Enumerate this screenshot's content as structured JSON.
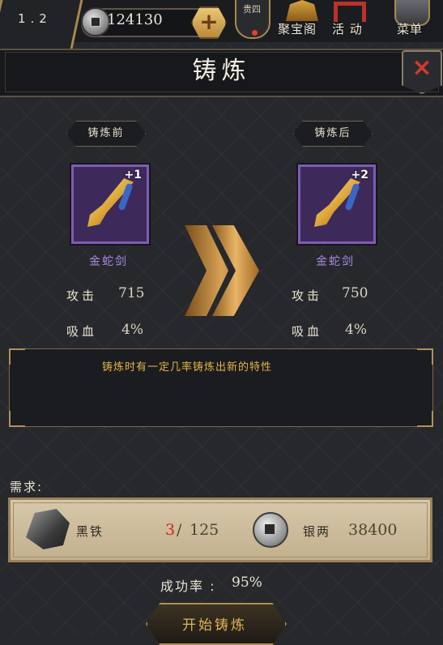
{
  "topbar": {
    "level": "1.2",
    "money": "124130",
    "plus_label": "+",
    "vip_label": "贵四",
    "buttons": {
      "treasure_label": "聚宝阁",
      "event_label": "活 动",
      "menu_label": "菜单"
    }
  },
  "title": "铸炼",
  "close_label": "×",
  "before": {
    "tag": "铸炼前",
    "item_name": "金蛇剑",
    "enhance": "+1",
    "stats": [
      {
        "label": "攻击",
        "value": "715"
      },
      {
        "label": "吸血",
        "value": "4%"
      }
    ]
  },
  "after": {
    "tag": "铸炼后",
    "item_name": "金蛇剑",
    "enhance": "+2",
    "stats": [
      {
        "label": "攻击",
        "value": "750"
      },
      {
        "label": "吸血",
        "value": "4%"
      }
    ]
  },
  "info_text": "铸炼时有一定几率铸炼出新的特性",
  "requirements": {
    "label": "需求:",
    "material": {
      "name": "黑铁",
      "have": "3",
      "separator": "/",
      "need": "125"
    },
    "currency": {
      "name": "银两",
      "amount": "38400"
    }
  },
  "success_rate": {
    "label": "成功率 :",
    "value": "95%"
  },
  "start_button": "开始铸炼",
  "colors": {
    "quality_purple": "#7b5fb0",
    "gold": "#e0b456",
    "insufficient_red": "#d0261c"
  },
  "icons": [
    "silver-coin-icon",
    "plus-icon",
    "treasure-icon",
    "event-icon",
    "menu-icon",
    "close-icon",
    "sword-icon",
    "forward-arrow-icon",
    "iron-ore-icon"
  ]
}
